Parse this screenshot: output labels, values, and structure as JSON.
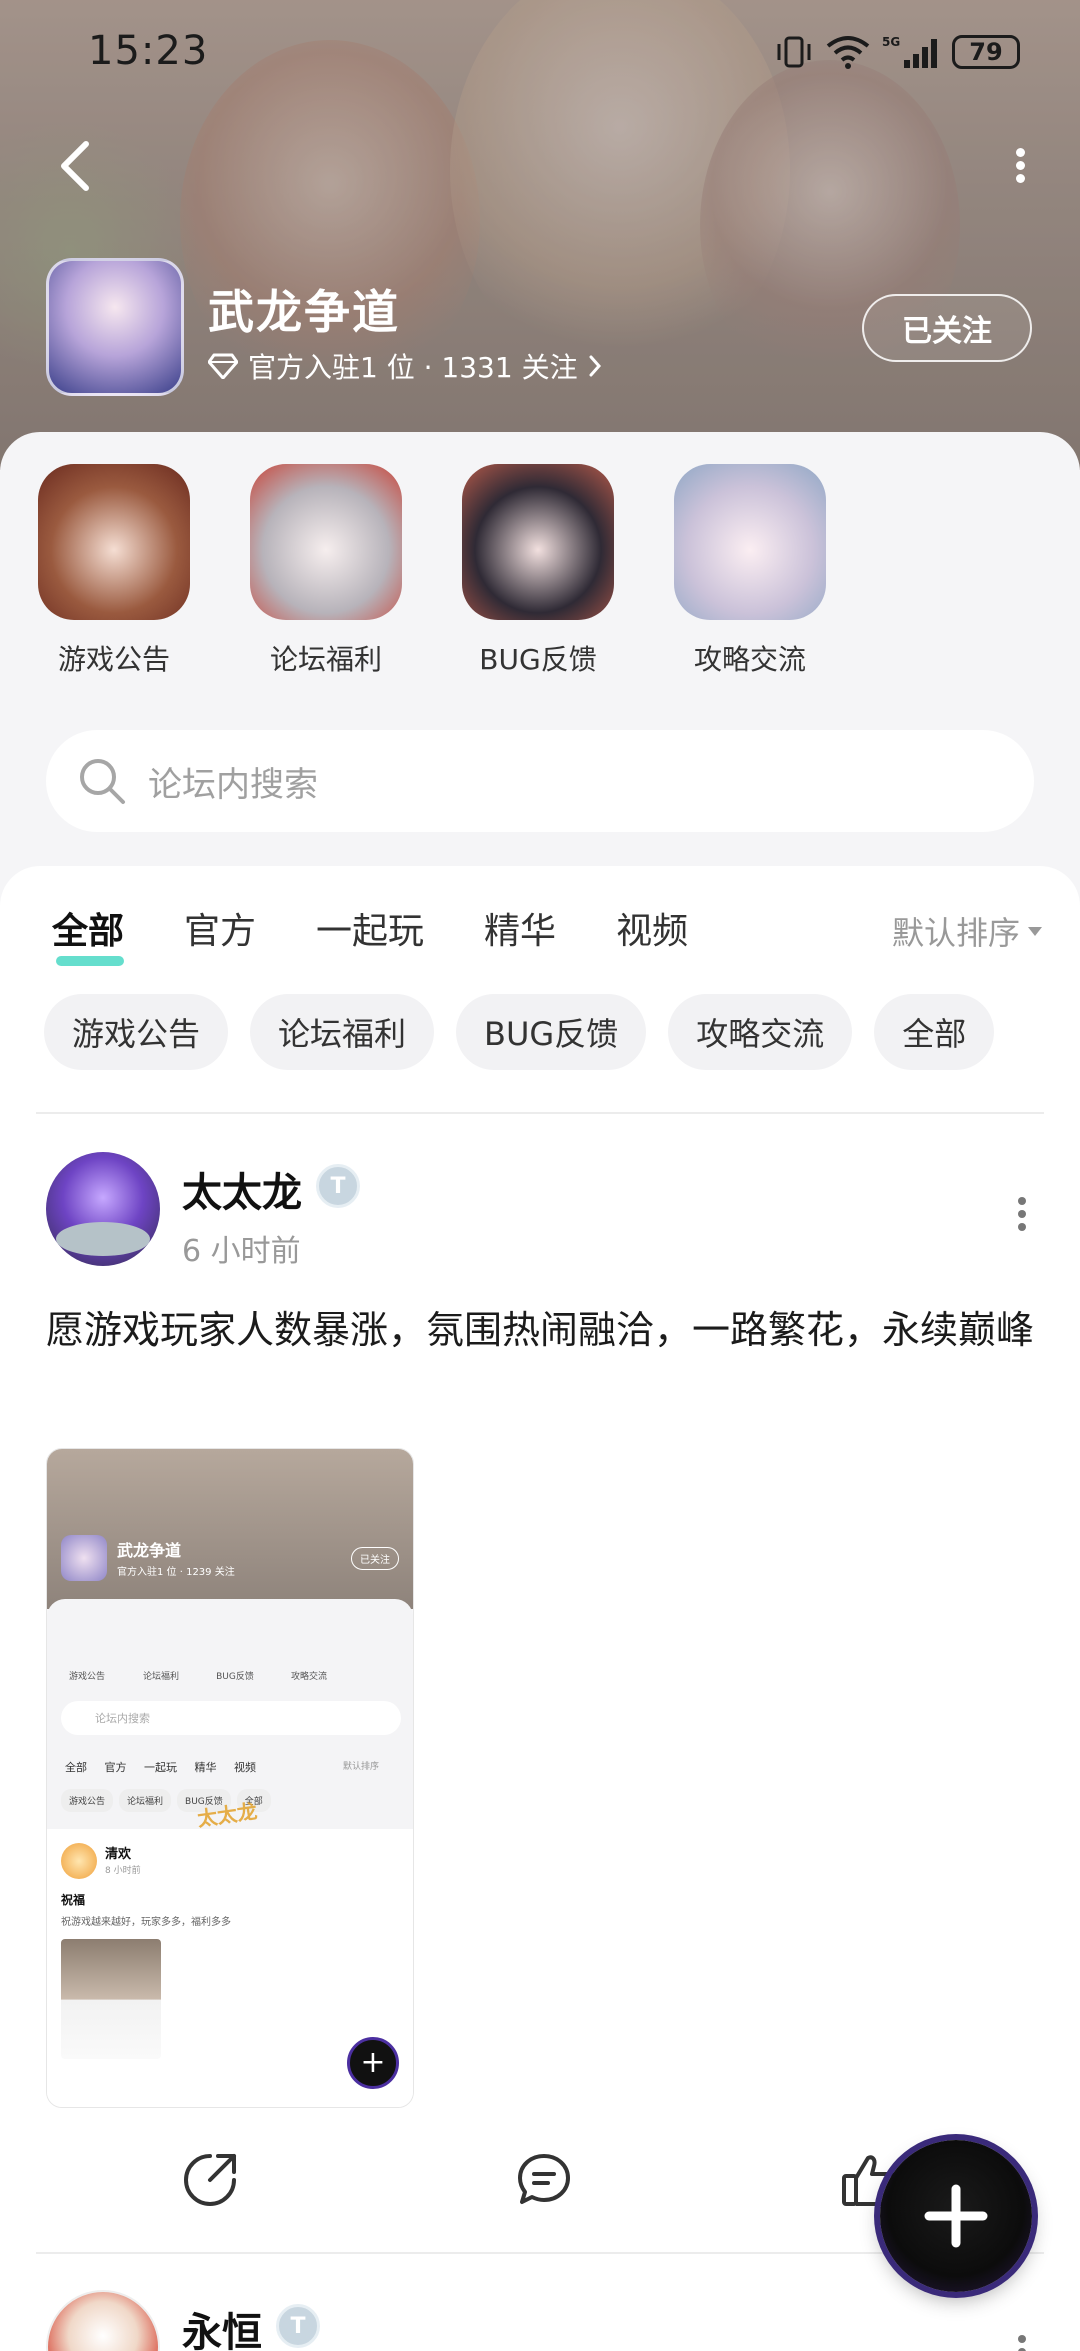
{
  "status_bar": {
    "time": "15:23",
    "battery": "79"
  },
  "header": {
    "forum_name": "武龙争道",
    "meta": "官方入驻1 位 · 1331 关注",
    "follow_label": "已关注"
  },
  "categories": [
    {
      "label": "游戏公告"
    },
    {
      "label": "论坛福利"
    },
    {
      "label": "BUG反馈"
    },
    {
      "label": "攻略交流"
    }
  ],
  "search": {
    "placeholder": "论坛内搜索"
  },
  "tabs": [
    {
      "label": "全部",
      "active": true
    },
    {
      "label": "官方"
    },
    {
      "label": "一起玩"
    },
    {
      "label": "精华"
    },
    {
      "label": "视频"
    }
  ],
  "sort_label": "默认排序",
  "chips": [
    "游戏公告",
    "论坛福利",
    "BUG反馈",
    "攻略交流",
    "全部"
  ],
  "posts": [
    {
      "author": "太太龙",
      "time": "6 小时前",
      "text": "愿游戏玩家人数暴涨，氛围热闹融洽，一路繁花，永续巅峰",
      "screenshot": {
        "title": "武龙争道",
        "meta": "官方入驻1 位 · 1239 关注",
        "follow": "已关注",
        "categories": [
          "游戏公告",
          "论坛福利",
          "BUG反馈",
          "攻略交流"
        ],
        "search": "论坛内搜索",
        "tabs": "全部 官方 一起玩 精华 视频",
        "sort": "默认排序",
        "chips": [
          "游戏公告",
          "论坛福利",
          "BUG反馈",
          "全部"
        ],
        "watermark": "太太龙",
        "post_author": "清欢",
        "post_time": "8 小时前",
        "post_title": "祝福",
        "post_text": "祝游戏越来越好，玩家多多，福利多多"
      }
    },
    {
      "author": "永恒"
    }
  ],
  "colors": {
    "accent_underline": "#3ed6c0",
    "fab_ring": "#3a2a7a"
  }
}
